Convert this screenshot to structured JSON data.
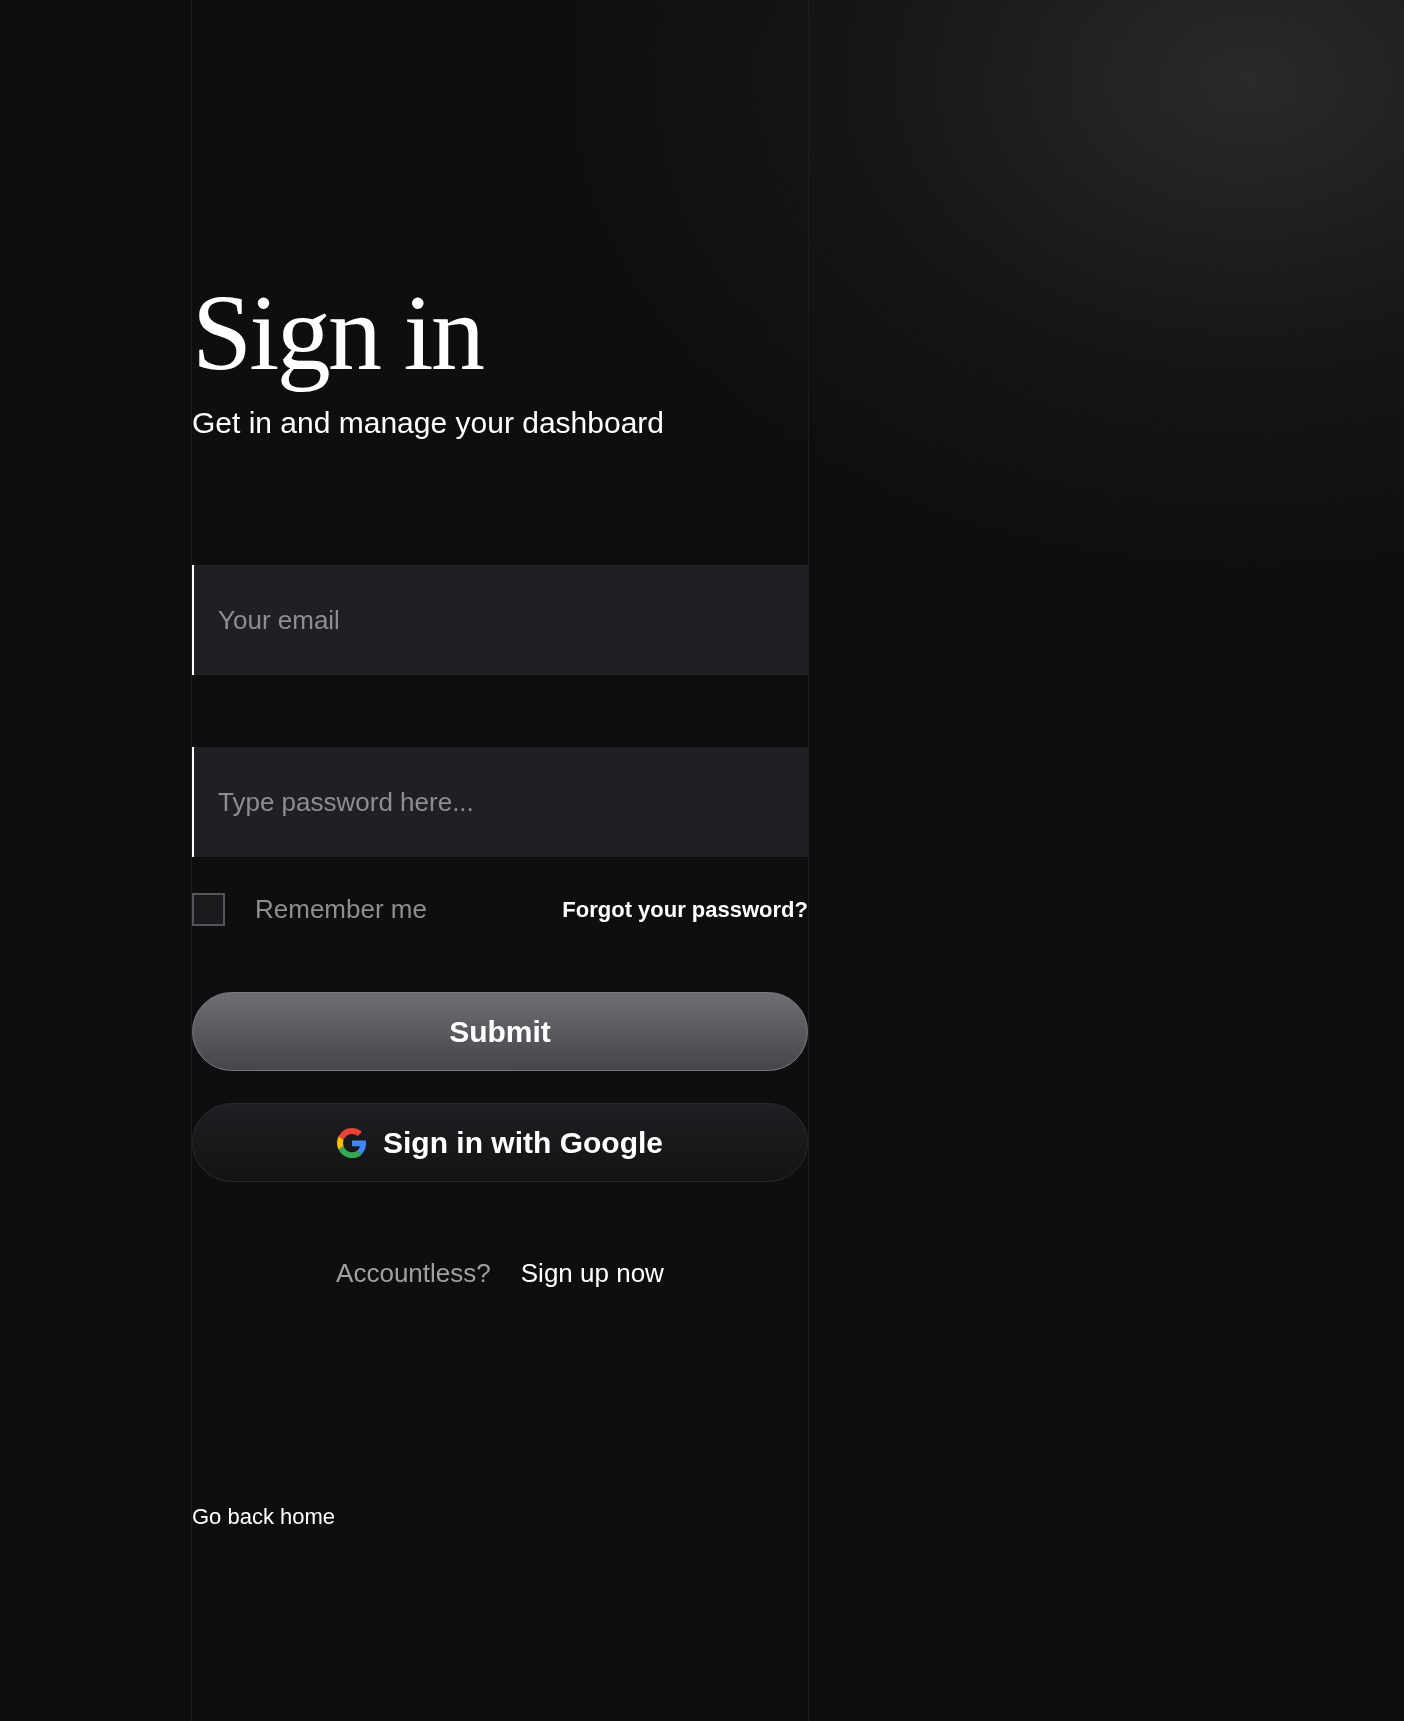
{
  "title": "Sign in",
  "subtitle": "Get in and manage your dashboard",
  "email": {
    "placeholder": "Your email"
  },
  "password": {
    "placeholder": "Type password here..."
  },
  "remember": {
    "label": "Remember me",
    "checked": false
  },
  "forgot_link": "Forgot your password?",
  "submit_button": "Submit",
  "google_button": "Sign in with Google",
  "signup": {
    "prompt": "Accountless?",
    "link": "Sign up now"
  },
  "home_link": "Go back home"
}
